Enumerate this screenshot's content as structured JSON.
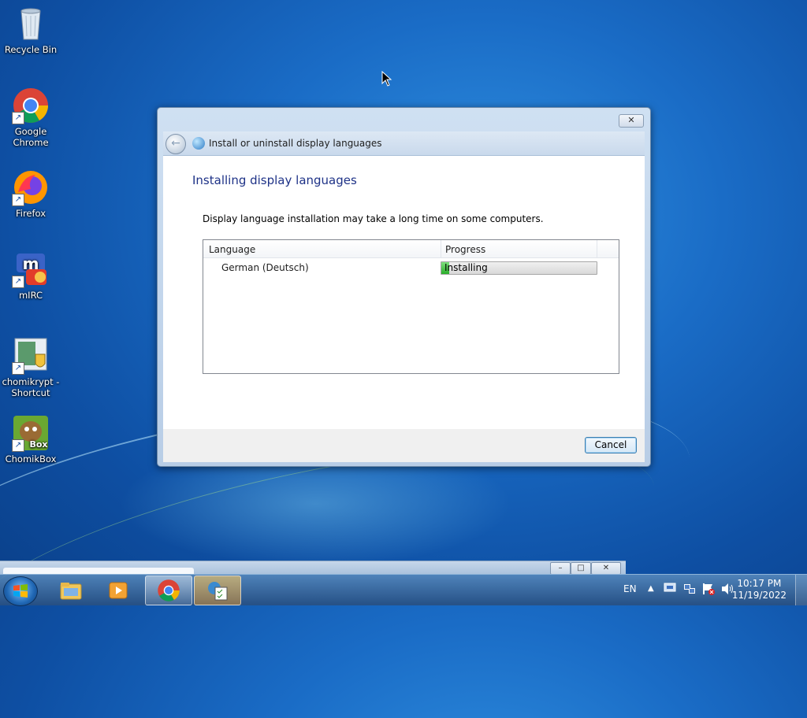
{
  "desktop": {
    "icons": [
      {
        "label": "Recycle Bin",
        "icon": "recycle-bin-icon"
      },
      {
        "label": "Google Chrome",
        "icon": "chrome-icon"
      },
      {
        "label": "Firefox",
        "icon": "firefox-icon"
      },
      {
        "label": "mIRC",
        "icon": "mirc-icon"
      },
      {
        "label": "chomikrypt - Shortcut",
        "icon": "chomikrypt-icon"
      },
      {
        "label": "ChomikBox",
        "icon": "chomikbox-icon"
      }
    ]
  },
  "dialog": {
    "close_label": "✕",
    "nav_title": "Install or uninstall display languages",
    "heading": "Installing display languages",
    "description": "Display language installation may take a long time on some computers.",
    "columns": [
      "Language",
      "Progress"
    ],
    "rows": [
      {
        "language": "German (Deutsch)",
        "status": "Installing",
        "progress_fraction": 0.05
      }
    ],
    "cancel_label": "Cancel"
  },
  "background_window": {
    "minimize": "–",
    "maximize": "□",
    "close": "✕"
  },
  "taskbar": {
    "language": "EN",
    "time": "10:17 PM",
    "date": "11/19/2022",
    "items": [
      "start-button",
      "explorer",
      "media-player",
      "chrome",
      "language-installer"
    ]
  },
  "colors": {
    "heading": "#1e3287",
    "progress_green": "#2aad2a",
    "desktop_blue": "#1a6cc6"
  }
}
